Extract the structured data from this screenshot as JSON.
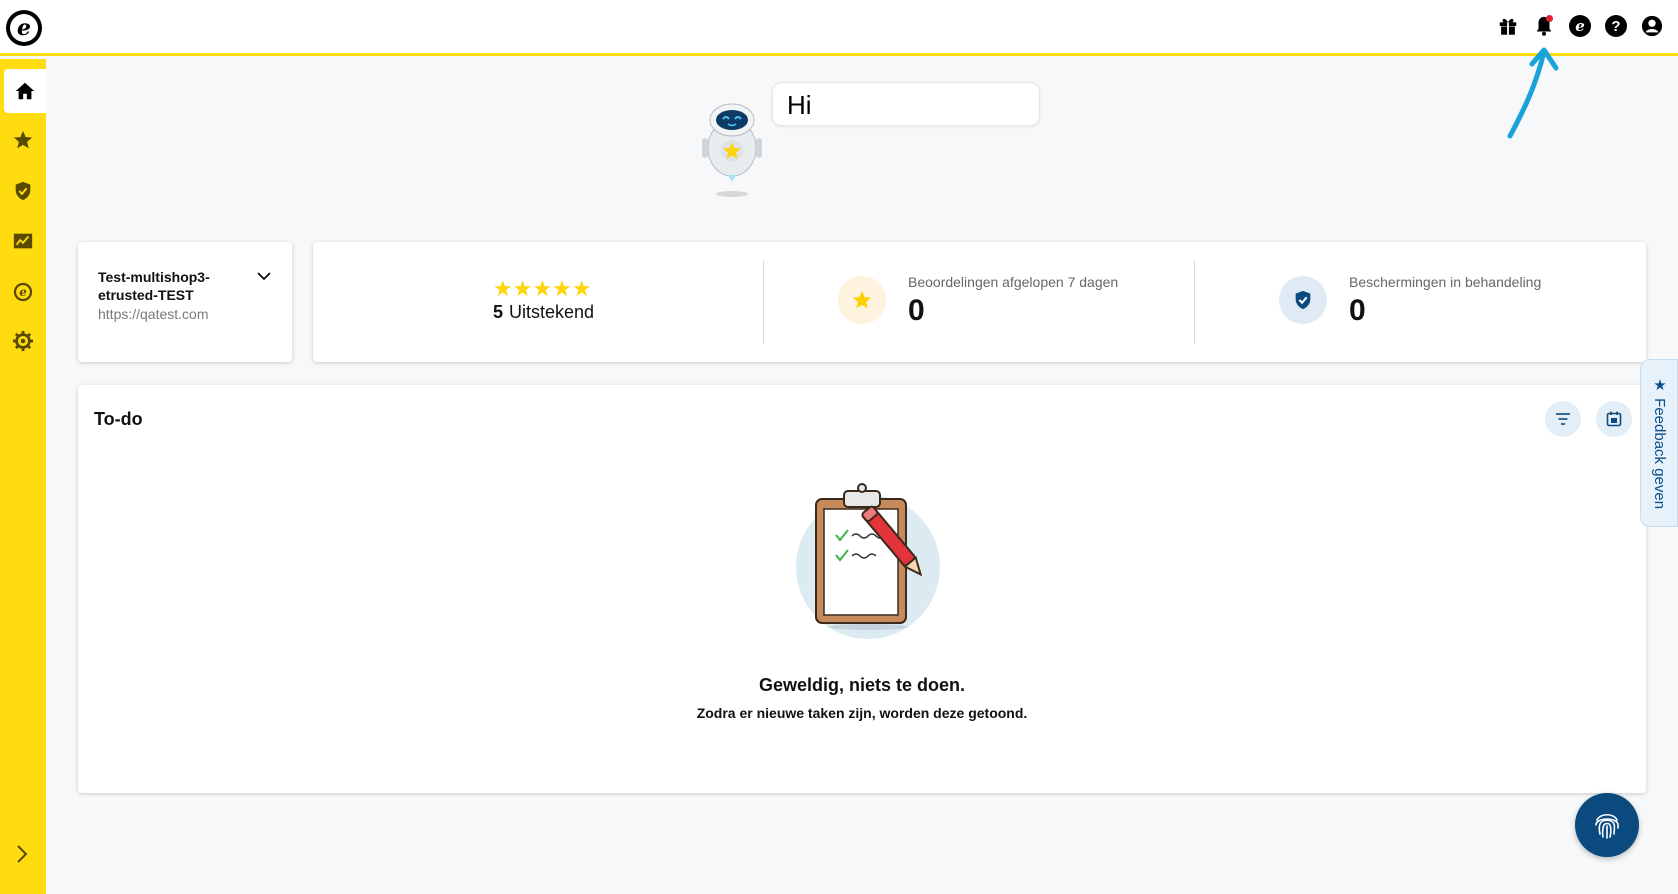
{
  "header": {
    "logo_letter": "e",
    "icons": [
      "gift-icon",
      "bell-icon",
      "etrusted-icon",
      "help-icon",
      "account-icon"
    ],
    "has_notification": true,
    "help_glyph": "?",
    "etrusted_glyph": "e"
  },
  "sidebar": {
    "items": [
      {
        "name": "home-icon",
        "active": true
      },
      {
        "name": "star-icon",
        "active": false
      },
      {
        "name": "shield-check-icon",
        "active": false
      },
      {
        "name": "chart-icon",
        "active": false
      },
      {
        "name": "etrusted-icon",
        "active": false
      },
      {
        "name": "gear-icon",
        "active": false
      }
    ],
    "expand_icon": "chevron-right-icon"
  },
  "greeting": {
    "text": "Hi"
  },
  "shop": {
    "name": "Test-multishop3-etrusted-TEST",
    "url": "https://qatest.com"
  },
  "stats": {
    "stars": "★★★★★",
    "rating_value": "5",
    "rating_label": "Uitstekend",
    "reviews_label": "Beoordelingen afgelopen 7 dagen",
    "reviews_value": "0",
    "protections_label": "Beschermingen in behandeling",
    "protections_value": "0"
  },
  "todo": {
    "title": "To-do",
    "empty_title": "Geweldig, niets te doen.",
    "empty_subtitle": "Zodra er nieuwe taken zijn, worden deze getoond."
  },
  "feedback": {
    "label": "★ Feedback geven"
  },
  "colors": {
    "brand_yellow": "#ffdc0f",
    "primary_blue": "#0b4a7e",
    "annotation_blue": "#1aa3d9",
    "notification_red": "#e2202f"
  }
}
